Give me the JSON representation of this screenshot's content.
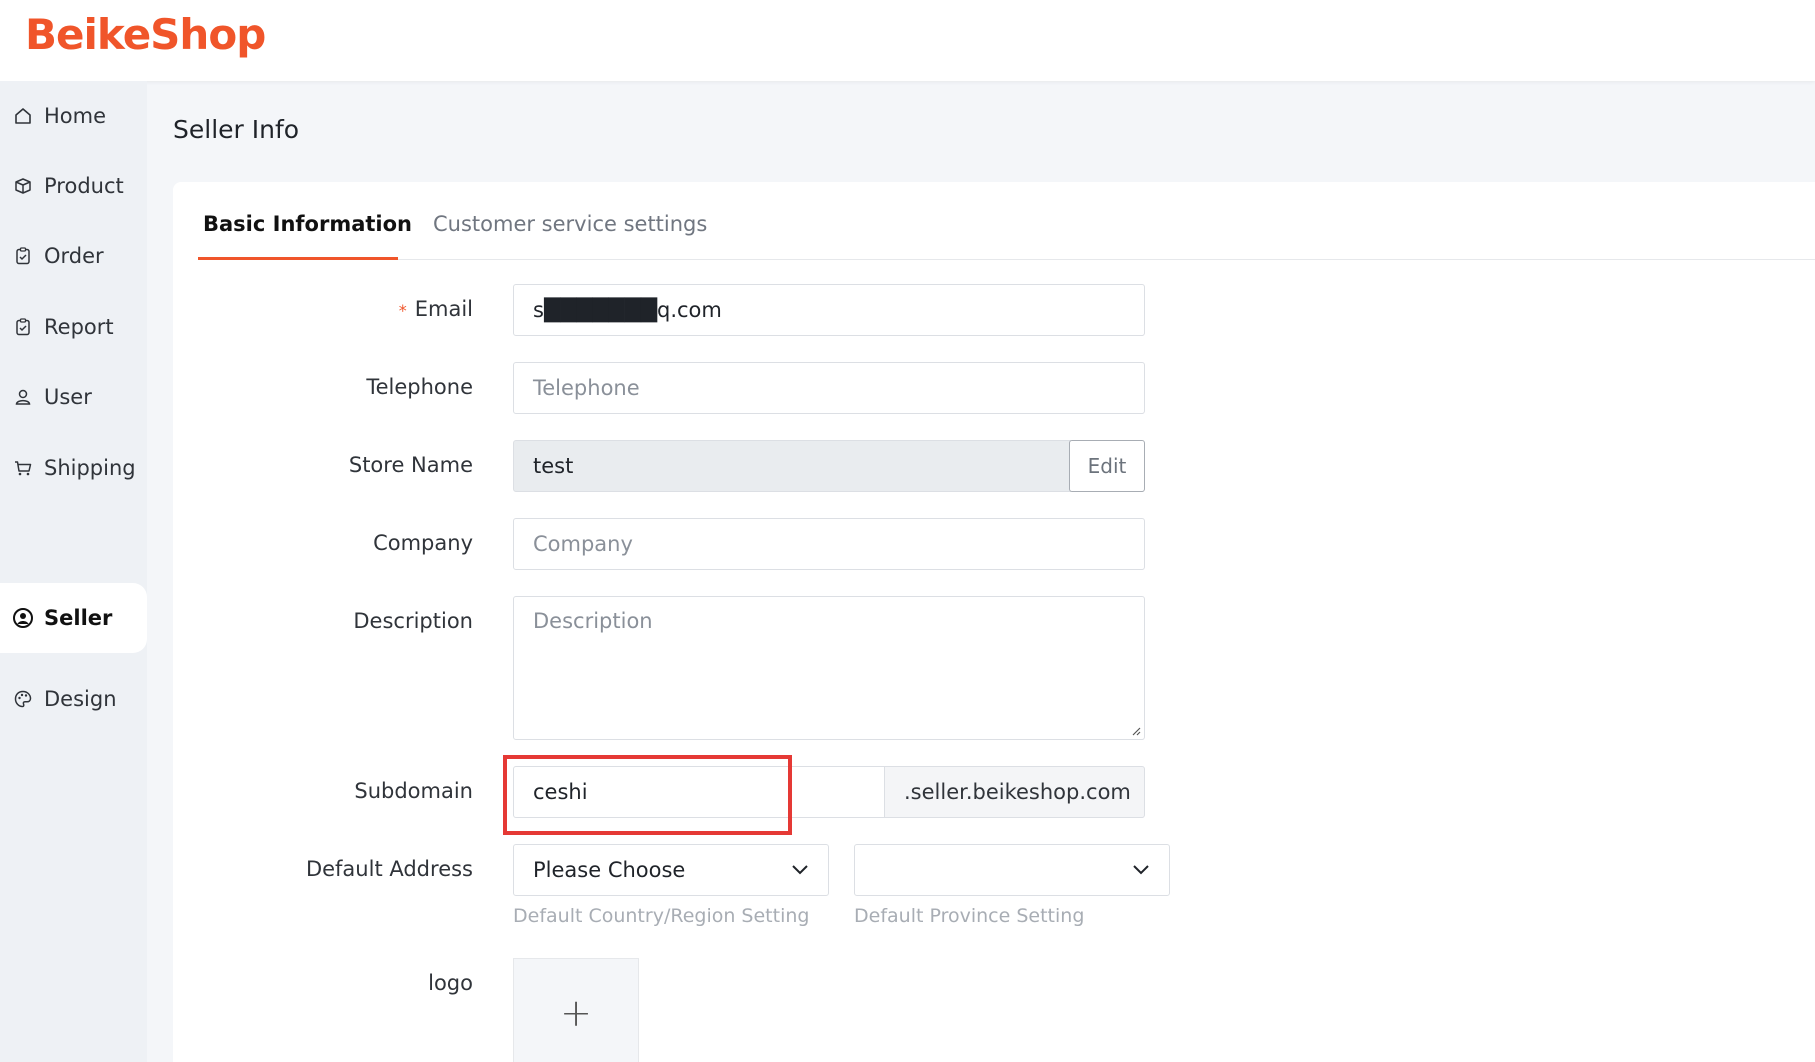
{
  "brand": {
    "logo_text": "BeikeShop",
    "color": "#f0552a"
  },
  "sidebar": {
    "items": [
      {
        "label": "Home",
        "icon": "home-icon",
        "active": false
      },
      {
        "label": "Product",
        "icon": "box-icon",
        "active": false
      },
      {
        "label": "Order",
        "icon": "clipboard-icon",
        "active": false
      },
      {
        "label": "Report",
        "icon": "clipboard-icon",
        "active": false
      },
      {
        "label": "User",
        "icon": "user-icon",
        "active": false
      },
      {
        "label": "Shipping",
        "icon": "cart-icon",
        "active": false
      },
      {
        "label": "Seller",
        "icon": "user-circle-icon",
        "active": true
      },
      {
        "label": "Design",
        "icon": "palette-icon",
        "active": false
      }
    ]
  },
  "page": {
    "title": "Seller Info"
  },
  "tabs": [
    {
      "label": "Basic Information",
      "active": true
    },
    {
      "label": "Customer service settings",
      "active": false
    }
  ],
  "form": {
    "email": {
      "label": "Email",
      "required_mark": "*",
      "value": "s███████q.com"
    },
    "telephone": {
      "label": "Telephone",
      "placeholder": "Telephone"
    },
    "store_name": {
      "label": "Store Name",
      "value": "test",
      "edit_label": "Edit"
    },
    "company": {
      "label": "Company",
      "placeholder": "Company"
    },
    "description": {
      "label": "Description",
      "placeholder": "Description"
    },
    "subdomain": {
      "label": "Subdomain",
      "value": "ceshi",
      "suffix": ".seller.beikeshop.com"
    },
    "default_address": {
      "label": "Default Address",
      "country_value": "Please Choose",
      "province_value": "",
      "country_hint": "Default Country/Region Setting",
      "province_hint": "Default Province Setting"
    },
    "logo": {
      "label": "logo",
      "upload_glyph": "+"
    }
  },
  "colors": {
    "accent": "#f0552a",
    "highlight": "#e53935"
  }
}
